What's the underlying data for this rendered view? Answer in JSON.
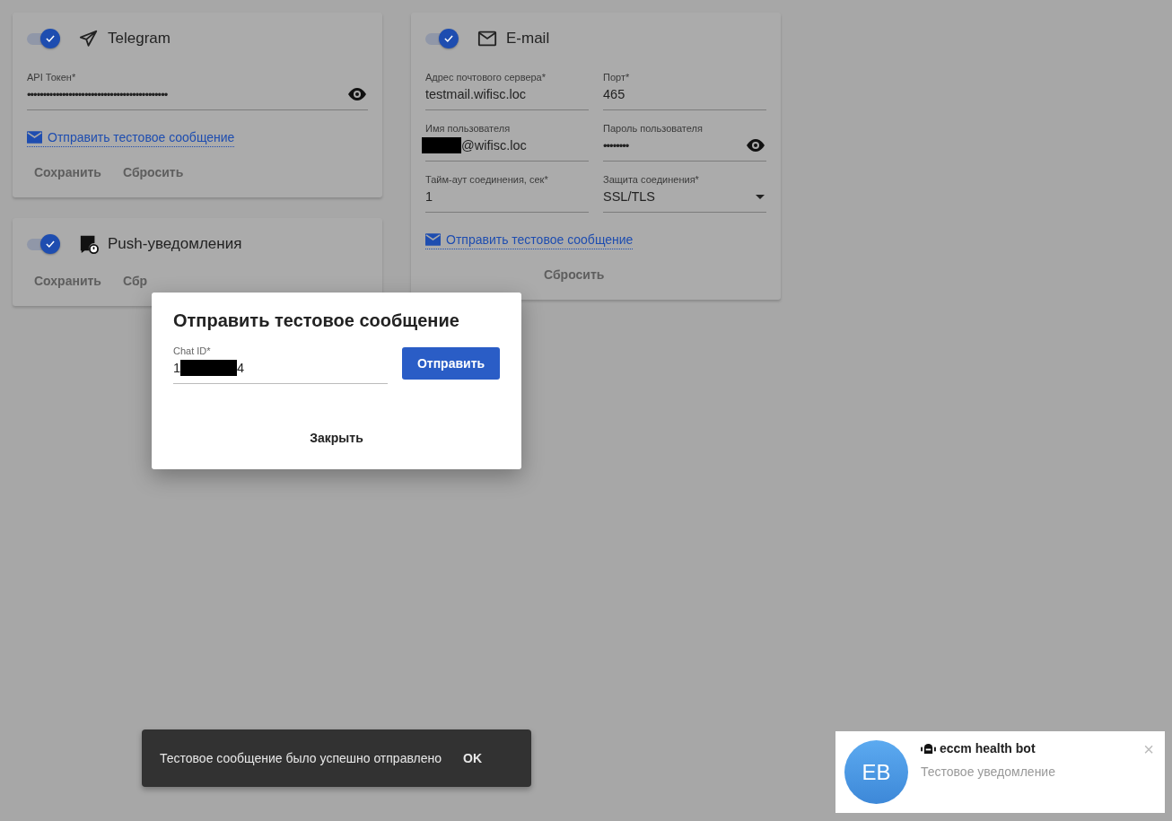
{
  "columns": [
    [
      {
        "kind": "telegram",
        "title": "Telegram",
        "enabled": true,
        "fields": [
          {
            "kind": "password",
            "label": "API Токен*",
            "value": "••••••••••••••••••••••••••••••••••••••••••••"
          }
        ],
        "test_link": "Отправить тестовое сообщение",
        "buttons": [
          {
            "label": "Сохранить",
            "disabled": true
          },
          {
            "label": "Сбросить",
            "disabled": true
          }
        ]
      },
      {
        "kind": "push",
        "title": "Push-уведомления",
        "enabled": true,
        "buttons": [
          {
            "label": "Сохранить",
            "disabled": true
          },
          {
            "label": "Сбр",
            "disabled": true
          }
        ]
      }
    ],
    [
      {
        "kind": "email",
        "title": "E-mail",
        "enabled": true,
        "fields": [
          {
            "kind": "text",
            "label": "Адрес почтового сервера*",
            "value": "testmail.wifisc.loc"
          },
          {
            "kind": "text",
            "label": "Порт*",
            "value": "465"
          },
          {
            "kind": "redacted",
            "label": "Имя пользователя",
            "segments": [
              {
                "kind": "redacted"
              },
              {
                "kind": "text",
                "text": "@wifisc.loc"
              }
            ]
          },
          {
            "kind": "password",
            "label": "Пароль пользователя",
            "value": "••••••••"
          },
          {
            "kind": "text",
            "label": "Тайм-аут соединения, сек*",
            "value": "1"
          },
          {
            "kind": "select",
            "label": "Защита соединения*",
            "value": "SSL/TLS"
          }
        ],
        "test_link": "Отправить тестовое сообщение",
        "buttons": [
          {
            "label": "Сбросить",
            "disabled": true
          }
        ]
      }
    ]
  ],
  "dialog": {
    "title": "Отправить тестовое сообщение",
    "field": {
      "label": "Chat ID*",
      "segments": [
        {
          "kind": "text",
          "text": "1"
        },
        {
          "kind": "redacted"
        },
        {
          "kind": "text",
          "text": "4"
        }
      ]
    },
    "send_button": "Отправить",
    "close_button": "Закрыть"
  },
  "snackbar": {
    "message": "Тестовое сообщение было успешно отправлено",
    "action": "OK"
  },
  "notification": {
    "avatar": "EB",
    "sender": "eccm health bot",
    "message": "Тестовое уведомление",
    "close": "×"
  }
}
